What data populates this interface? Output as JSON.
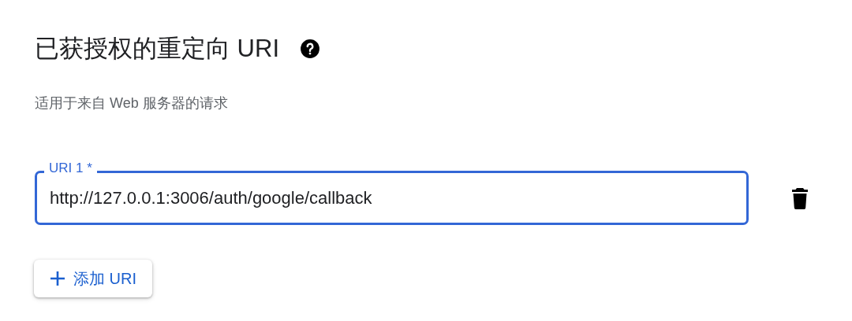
{
  "heading": "已获授权的重定向 URI",
  "description": "适用于来自 Web 服务器的请求",
  "uris": [
    {
      "label": "URI 1 *",
      "value": "http://127.0.0.1:3006/auth/google/callback",
      "focused": true
    }
  ],
  "add_button": {
    "label": "添加 URI"
  }
}
